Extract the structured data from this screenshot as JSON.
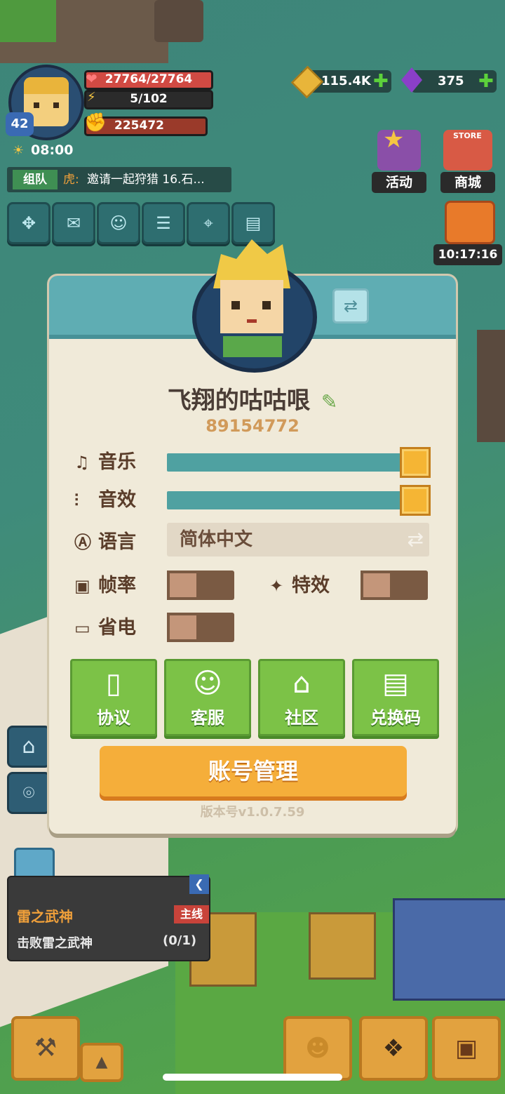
{
  "player": {
    "level": "42",
    "hp": "27764/27764",
    "energy": "5/102",
    "power": "225472",
    "time": "08:00"
  },
  "resources": {
    "gold": "115.4K",
    "gems": "375"
  },
  "chat": {
    "channel": "组队",
    "sender": "虎:",
    "message": "邀请一起狩猎 16.石..."
  },
  "side_buttons": {
    "activity": "活动",
    "store": "商城",
    "store_sign": "STORE",
    "timer": "10:17:16"
  },
  "profile": {
    "name": "飞翔的咕咕哏",
    "id": "89154772"
  },
  "settings": {
    "music_label": "音乐",
    "music_level": 1.0,
    "sfx_label": "音效",
    "sfx_level": 1.0,
    "language_label": "语言",
    "language_value": "简体中文",
    "framerate_label": "帧率",
    "effects_label": "特效",
    "power_save_label": "省电",
    "framerate_on": false,
    "effects_on": false,
    "power_save_on": false
  },
  "actions": {
    "agreement": "协议",
    "service": "客服",
    "community": "社区",
    "redeem": "兑换码",
    "account": "账号管理"
  },
  "version": "版本号v1.0.7.59",
  "quest": {
    "title": "雷之武神",
    "tag": "主线",
    "desc": "击败雷之武神",
    "progress": "(0/1)"
  },
  "colors": {
    "header_teal": "#5fadb3",
    "panel_bg": "#f0ead9",
    "slider_fill": "#4fa1a1",
    "knob_orange": "#f5b534",
    "action_green": "#7cc247",
    "account_orange": "#f5ae3a",
    "text_brown": "#5a3d2a"
  }
}
